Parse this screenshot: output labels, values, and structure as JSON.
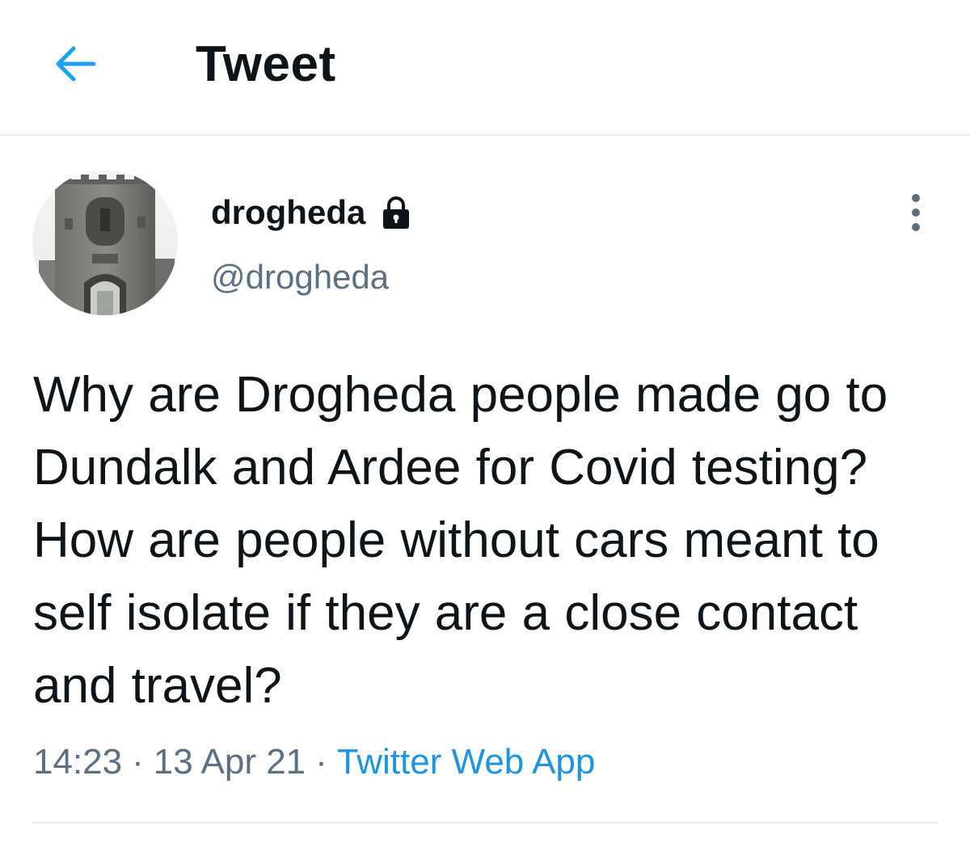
{
  "header": {
    "title": "Tweet",
    "back_icon": "arrow-left-icon",
    "accent_color": "#1da1f2"
  },
  "tweet": {
    "author": {
      "display_name": "drogheda",
      "handle": "@drogheda",
      "protected_icon": "lock-icon",
      "avatar": "stone-gate-photo"
    },
    "more_icon": "more-vertical-icon",
    "text": "Why are Drogheda people made go to Dundalk and Ardee for Covid testing? How are people without cars meant to self isolate if they are a close contact and travel?",
    "time": "14:23",
    "date": "13 Apr 21",
    "separator": "·",
    "source": "Twitter Web App",
    "source_color": "#1b95e0",
    "muted_color": "#5b7083"
  }
}
